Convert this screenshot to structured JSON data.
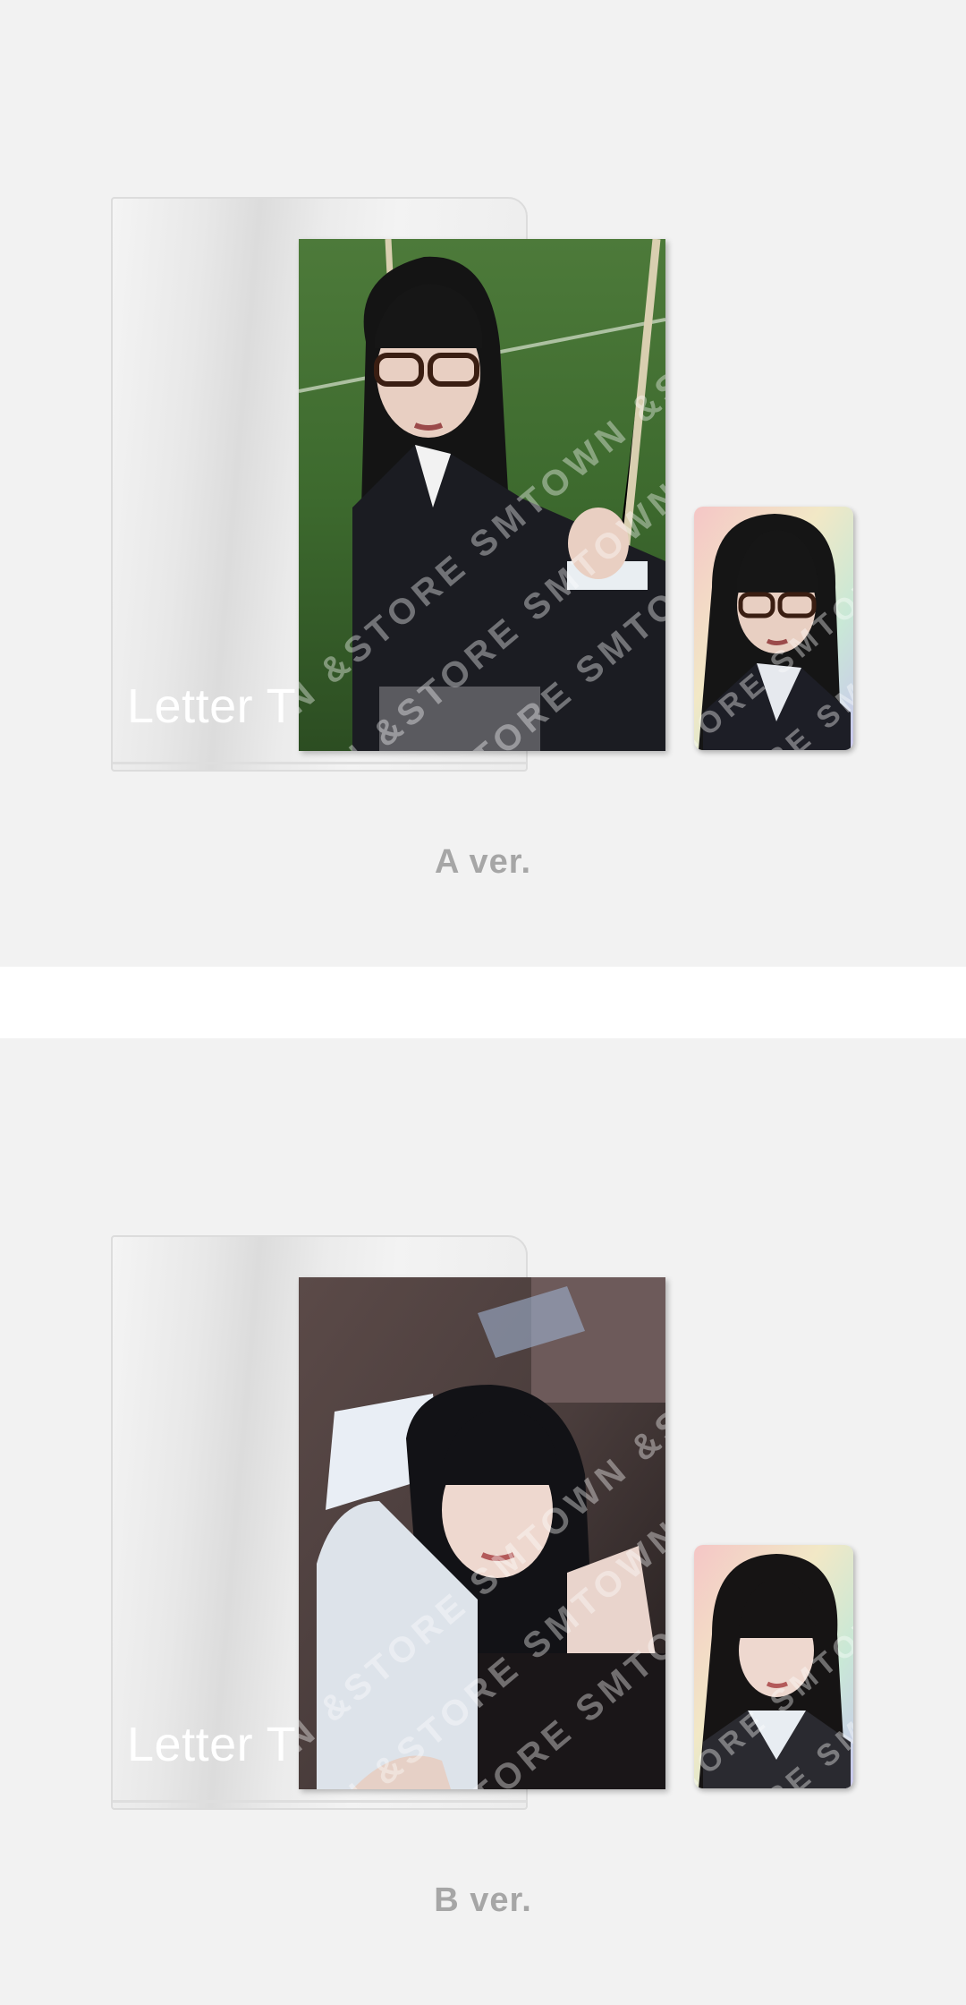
{
  "versions": [
    {
      "folder_label": "Letter T",
      "watermark": "SMTOWN &STORE SMTOWN &STORE",
      "version_label": "A ver."
    },
    {
      "folder_label": "Letter T",
      "watermark": "SMTOWN &STORE SMTOWN &STORE",
      "version_label": "B ver."
    }
  ],
  "colors": {
    "panel_background": "#f2f2f2",
    "separator": "#ffffff",
    "version_text": "#a6a6a6"
  }
}
